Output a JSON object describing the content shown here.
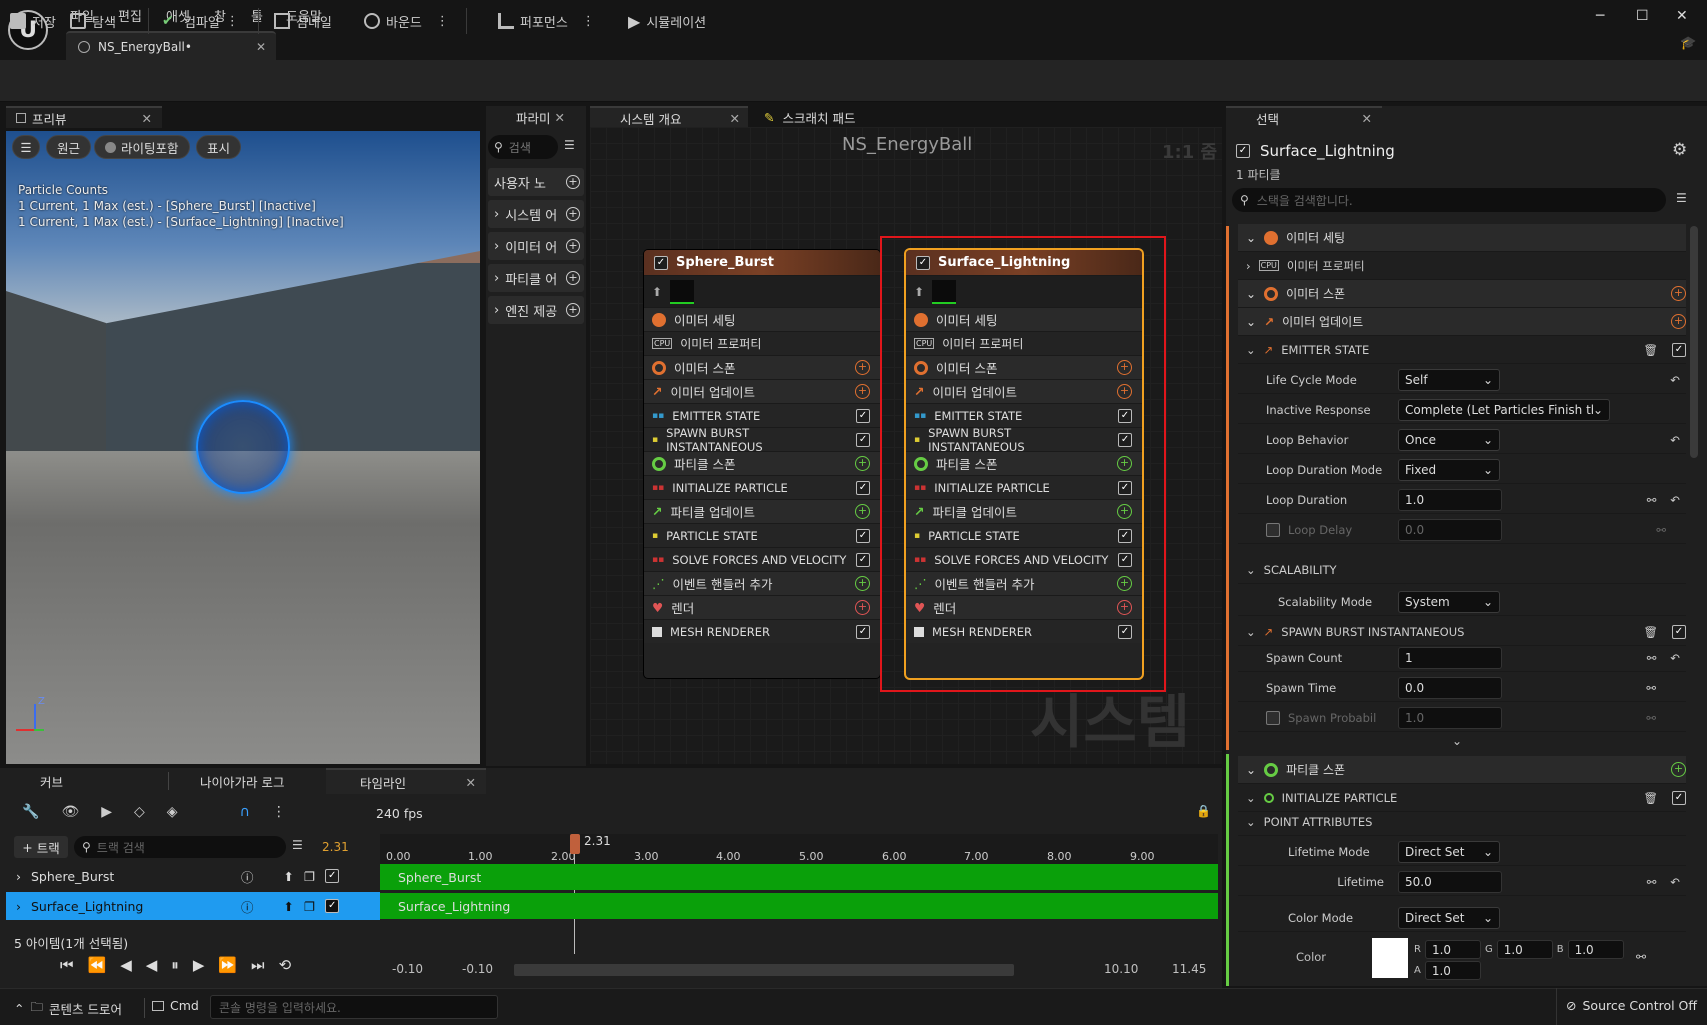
{
  "menu": [
    "파일",
    "편집",
    "애셋",
    "창",
    "툴",
    "도움말"
  ],
  "doc_tab": "NS_EnergyBall•",
  "toolbar": {
    "save": "저장",
    "browse": "탐색",
    "compile": "컴파일",
    "thumbnail": "섬네일",
    "bounds": "바운드",
    "performance": "퍼포먼스",
    "simulation": "시뮬레이션"
  },
  "preview": {
    "tab": "프리뷰",
    "chips": [
      "원근",
      "라이팅포함",
      "표시"
    ],
    "counts_title": "Particle Counts",
    "counts": [
      "1 Current, 1 Max (est.) - [Sphere_Burst] [Inactive]",
      "1 Current, 1 Max (est.) - [Surface_Lightning] [Inactive]"
    ]
  },
  "palette": {
    "tab": "파라미",
    "search": "검색",
    "items": [
      "사용자 노",
      "시스템 어",
      "이미터 어",
      "파티클 어",
      "엔진 제공"
    ]
  },
  "graph": {
    "tabs": [
      "시스템 개요",
      "스크래치 패드"
    ],
    "title": "NS_EnergyBall",
    "zoom": "1:1 줌",
    "watermark": "시스템",
    "nodes": [
      {
        "name": "Sphere_Burst"
      },
      {
        "name": "Surface_Lightning"
      }
    ],
    "rows": [
      "이미터 세팅",
      "이미터 프로퍼티",
      "이미터 스폰",
      "이미터 업데이트",
      "EMITTER STATE",
      "SPAWN BURST INSTANTANEOUS",
      "파티클 스폰",
      "INITIALIZE PARTICLE",
      "파티클 업데이트",
      "PARTICLE STATE",
      "SOLVE FORCES AND VELOCITY",
      "이벤트 핸들러 추가",
      "렌더",
      "MESH RENDERER"
    ]
  },
  "selection": {
    "tab": "선택",
    "name": "Surface_Lightning",
    "count": "1 파티클",
    "search_placeholder": "스택을 검색합니다.",
    "emitter_settings": "이미터 세팅",
    "emitter_props": "이미터 프로퍼티",
    "emitter_spawn": "이미터 스폰",
    "emitter_update": "이미터 업데이트",
    "emitter_state": "EMITTER STATE",
    "props": [
      {
        "label": "Life Cycle Mode",
        "value": "Self",
        "type": "drop"
      },
      {
        "label": "Inactive Response",
        "value": "Complete (Let Particles Finish the",
        "type": "drop"
      },
      {
        "label": "Loop Behavior",
        "value": "Once",
        "type": "drop"
      },
      {
        "label": "Loop Duration Mode",
        "value": "Fixed",
        "type": "drop"
      },
      {
        "label": "Loop Duration",
        "value": "1.0",
        "type": "field"
      },
      {
        "label": "Loop Delay",
        "value": "0.0",
        "type": "field"
      }
    ],
    "scalability": "SCALABILITY",
    "scalability_mode_label": "Scalability Mode",
    "scalability_mode": "System",
    "spawn_burst": "SPAWN BURST INSTANTANEOUS",
    "spawn_count_label": "Spawn Count",
    "spawn_count": "1",
    "spawn_time_label": "Spawn Time",
    "spawn_time": "0.0",
    "spawn_prob_label": "Spawn Probabil",
    "spawn_prob": "1.0",
    "particle_spawn": "파티클 스폰",
    "init_particle": "INITIALIZE PARTICLE",
    "point_attrs": "POINT ATTRIBUTES",
    "lifetime_mode_label": "Lifetime Mode",
    "lifetime_mode": "Direct Set",
    "lifetime_label": "Lifetime",
    "lifetime": "50.0",
    "color_mode_label": "Color Mode",
    "color_mode": "Direct Set",
    "color_label": "Color",
    "color_r": "1.0",
    "color_g": "1.0",
    "color_b": "1.0",
    "color_a": "1.0"
  },
  "timeline": {
    "tabs": [
      "커브",
      "나이아가라 로그",
      "타임라인"
    ],
    "fps": "240 fps",
    "track_btn": "트랙",
    "track_search": "트랙 검색",
    "current": "2.31",
    "ticks": [
      "0.00",
      "1.00",
      "2.00",
      "3.00",
      "4.00",
      "5.00",
      "6.00",
      "7.00",
      "8.00",
      "9.00"
    ],
    "tracks": [
      "Sphere_Burst",
      "Surface_Lightning"
    ],
    "items_count": "5 아이템(1개 선택됨)",
    "range_start": "-0.10",
    "range_start2": "-0.10",
    "range_end": "10.10",
    "range_end2": "11.45"
  },
  "status": {
    "content_drawer": "콘텐츠 드로어",
    "cmd": "Cmd",
    "cmd_placeholder": "콘솔 명령을 입력하세요.",
    "source_control": "Source Control Off"
  }
}
